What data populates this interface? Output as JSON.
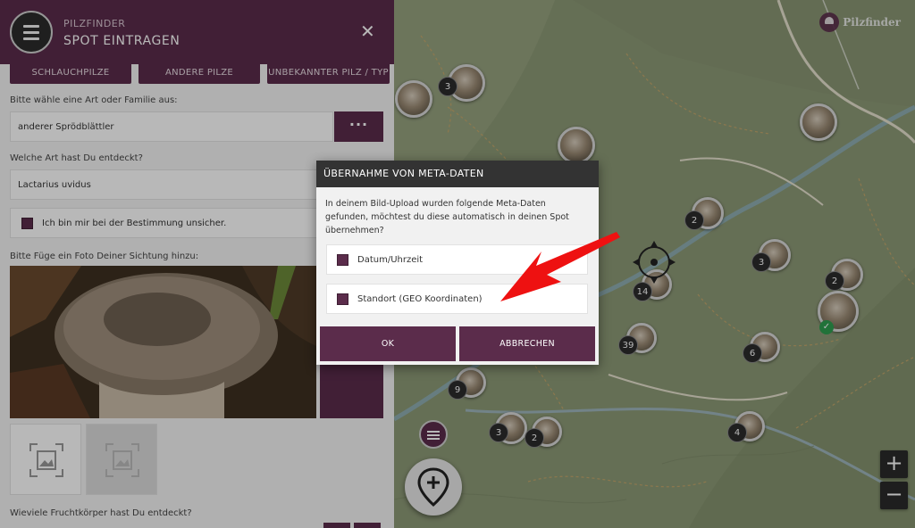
{
  "header": {
    "app_name": "PILZFINDER",
    "title": "SPOT EINTRAGEN",
    "close_label": "✕"
  },
  "categories": [
    "SCHLAUCHPILZE",
    "ANDERE PILZE",
    "UNBEKANNTER PILZ / TYP"
  ],
  "form": {
    "family_label": "Bitte wähle eine Art oder Familie aus:",
    "family_value": "anderer Sprödblättler",
    "species_label": "Welche Art hast Du entdeckt?",
    "species_value": "Lactarius uvidus",
    "unsure_label": "Ich bin mir bei der Bestimmung unsicher.",
    "photo_label": "Bitte Füge ein Foto Deiner Sichtung hinzu:",
    "count_label": "Wieviele Fruchtkörper hast Du entdeckt?"
  },
  "map": {
    "brand": "Pilzfinder",
    "zoom_in": "+",
    "zoom_out": "−",
    "clusters": [
      "3",
      "2",
      "3",
      "14",
      "2",
      "39",
      "6",
      "9",
      "3",
      "2",
      "4"
    ]
  },
  "dialog": {
    "title": "ÜBERNAHME VON META-DATEN",
    "message": "In deinem Bild-Upload wurden folgende Meta-Daten gefunden, möchtest du diese automatisch in deinen Spot übernehmen?",
    "option_datetime": "Datum/Uhrzeit",
    "option_location": "Standort (GEO Koordinaten)",
    "ok_label": "OK",
    "cancel_label": "ABBRECHEN"
  },
  "colors": {
    "brand": "#5b2c4b",
    "dialog_header": "#333333",
    "arrow": "#ee1111"
  }
}
